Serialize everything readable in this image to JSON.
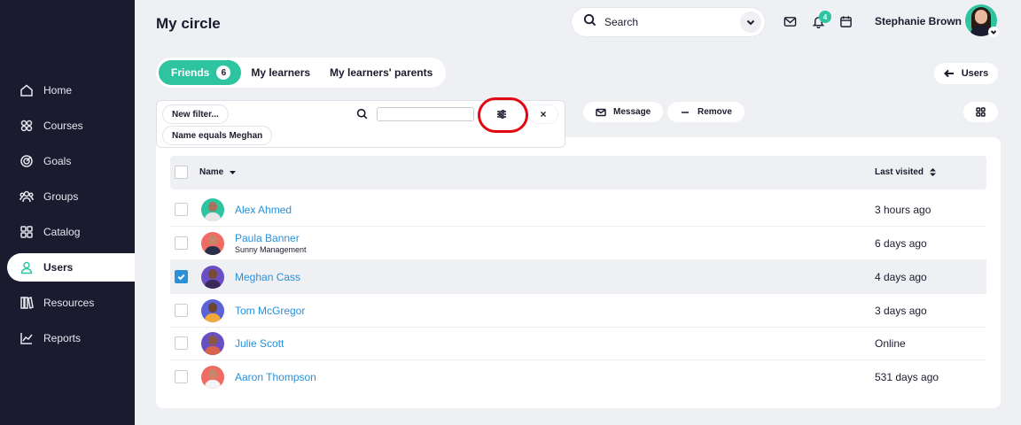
{
  "header": {
    "title": "My circle",
    "search_placeholder": "Search",
    "notification_count": "4",
    "user_name": "Stephanie Brown"
  },
  "sidebar": {
    "items": [
      {
        "label": "Home",
        "icon": "home-icon",
        "active": false
      },
      {
        "label": "Courses",
        "icon": "courses-icon",
        "active": false
      },
      {
        "label": "Goals",
        "icon": "goals-icon",
        "active": false
      },
      {
        "label": "Groups",
        "icon": "groups-icon",
        "active": false
      },
      {
        "label": "Catalog",
        "icon": "catalog-icon",
        "active": false
      },
      {
        "label": "Users",
        "icon": "users-icon",
        "active": true
      },
      {
        "label": "Resources",
        "icon": "resources-icon",
        "active": false
      },
      {
        "label": "Reports",
        "icon": "reports-icon",
        "active": false
      }
    ]
  },
  "tabs": [
    {
      "label": "Friends",
      "count": "6",
      "active": true
    },
    {
      "label": "My learners",
      "active": false
    },
    {
      "label": "My learners' parents",
      "active": false
    }
  ],
  "back_button": {
    "label": "Users"
  },
  "filter": {
    "new_filter_label": "New filter...",
    "active_filter_label": "Name equals Meghan",
    "close_label": "×"
  },
  "actions": {
    "message_label": "Message",
    "remove_label": "Remove"
  },
  "table": {
    "columns": {
      "name": "Name",
      "last_visited": "Last visited"
    },
    "rows": [
      {
        "name": "Alex Ahmed",
        "subtitle": "",
        "last_visited": "3 hours ago",
        "checked": false
      },
      {
        "name": "Paula Banner",
        "subtitle": "Sunny Management",
        "last_visited": "6 days ago",
        "checked": false
      },
      {
        "name": "Meghan Cass",
        "subtitle": "",
        "last_visited": "4 days ago",
        "checked": true
      },
      {
        "name": "Tom McGregor",
        "subtitle": "",
        "last_visited": "3 days ago",
        "checked": false
      },
      {
        "name": "Julie Scott",
        "subtitle": "",
        "last_visited": "Online",
        "checked": false
      },
      {
        "name": "Aaron Thompson",
        "subtitle": "",
        "last_visited": "531 days ago",
        "checked": false
      }
    ]
  },
  "colors": {
    "sidebar_bg": "#1a1b2e",
    "accent_green": "#2ec4a0",
    "link_blue": "#2a90d8",
    "highlight_red": "#e3050f",
    "page_bg": "#eef0f4"
  }
}
